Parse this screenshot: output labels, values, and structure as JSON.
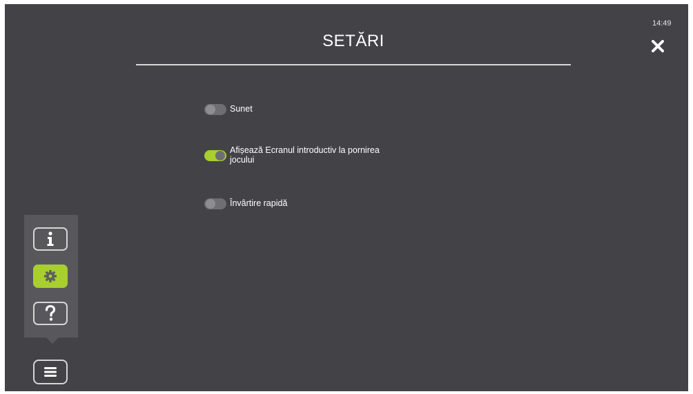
{
  "status": {
    "time": "14:49"
  },
  "header": {
    "title": "SETĂRI",
    "close_icon": "close-icon"
  },
  "settings": [
    {
      "label": "Sunet",
      "enabled": false
    },
    {
      "label": "Afișează Ecranul introductiv la pornirea jocului",
      "enabled": true
    },
    {
      "label": "Învârtire rapidă",
      "enabled": false
    }
  ],
  "side_menu": {
    "items": [
      {
        "icon": "info-icon",
        "active": false
      },
      {
        "icon": "gear-icon",
        "active": true
      },
      {
        "icon": "question-icon",
        "active": false
      }
    ],
    "menu_icon": "hamburger-icon"
  },
  "colors": {
    "background": "#434347",
    "accent": "#a8cf2d",
    "panel": "#58585c",
    "text": "#ffffff"
  }
}
